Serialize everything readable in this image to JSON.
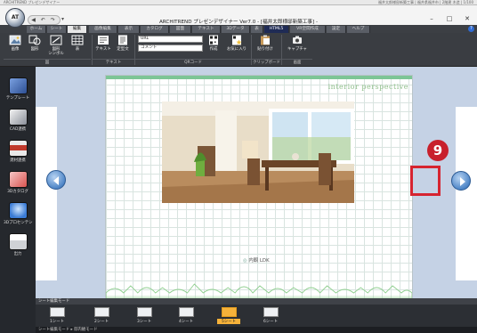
{
  "info_strip": {
    "left": "ARCHITREND プレゼンデザイナー",
    "right": "福井太郎様邸新築工事 | 福井県福井市 | 2階建 木造 | 1/100"
  },
  "window": {
    "orb_label": "AT",
    "qa_icons": "◀ ↶ ↷",
    "title": "ARCHITREND プレゼンデザイナー Ver7.0 - [福井太郎様邸新築工事] -",
    "minimize": "–",
    "maximize": "□",
    "close": "✕"
  },
  "tabs": [
    {
      "label": "ホーム",
      "state": "normal"
    },
    {
      "label": "シート",
      "state": "normal"
    },
    {
      "label": "編集",
      "state": "active"
    },
    {
      "label": "画像編集",
      "state": "normal"
    },
    {
      "label": "表示",
      "state": "normal"
    },
    {
      "label": "カタログ",
      "state": "normal"
    },
    {
      "label": "図面",
      "state": "normal"
    },
    {
      "label": "テキスト",
      "state": "normal"
    },
    {
      "label": "3Dデータ",
      "state": "normal"
    },
    {
      "label": "表",
      "state": "normal"
    },
    {
      "label": "HTML5",
      "state": "accent"
    },
    {
      "label": "VR空間作成",
      "state": "normal"
    },
    {
      "label": "設定",
      "state": "normal"
    },
    {
      "label": "ヘルプ",
      "state": "normal"
    }
  ],
  "help_label": "?",
  "ribbon": {
    "buttons": [
      {
        "label": "画像",
        "icon": "image-icon"
      },
      {
        "label": "図形",
        "icon": "shape-icon"
      },
      {
        "label": "図形\nシンボル",
        "icon": "symbol-icon"
      },
      {
        "label": "表",
        "icon": "table-icon"
      },
      {
        "label": "テキスト",
        "icon": "text-icon"
      },
      {
        "label": "定型文",
        "icon": "template-text-icon"
      },
      {
        "label": "作成",
        "icon": "qr-create-icon"
      },
      {
        "label": "お気に入り",
        "icon": "qr-favorite-icon"
      },
      {
        "label": "貼り付け",
        "icon": "paste-icon"
      },
      {
        "label": "キャプチャ",
        "icon": "capture-icon"
      }
    ],
    "qr_url_value": "URL",
    "qr_comment_value": "コメント",
    "groups": [
      "図",
      "テキスト",
      "QRコード",
      "クリップボード",
      "画面"
    ]
  },
  "left_toolbar": [
    {
      "label": "テンプレート",
      "icon": "template-icon",
      "color": "#4a6fb5"
    },
    {
      "label": "CAD連携",
      "icon": "cad-link-icon",
      "color": "#8a8f99"
    },
    {
      "label": "建材連携",
      "icon": "material-link-icon",
      "color": "#c0392b"
    },
    {
      "label": "3Dカタログ",
      "icon": "catalog-3d-icon",
      "color": "#d9534f"
    },
    {
      "label": "3Dプロセンテシ",
      "icon": "presentation-icon",
      "color": "#3a7bd5"
    },
    {
      "label": "出力",
      "icon": "print-icon",
      "color": "#dddddd"
    }
  ],
  "page": {
    "header_title": "interior perspective",
    "photo_caption": "内観 LDK",
    "accent_color": "#7dc596"
  },
  "nav": {
    "prev_label": "previous-page",
    "next_label": "next-page"
  },
  "annotation": {
    "step_number": "9",
    "color": "#c8202c"
  },
  "sheet_panel": {
    "mode_label": "シート編集モード",
    "sheets": [
      {
        "label": "1シート",
        "active": false
      },
      {
        "label": "2シート",
        "active": false
      },
      {
        "label": "3シート",
        "active": false
      },
      {
        "label": "4シート",
        "active": false
      },
      {
        "label": "5シート",
        "active": true
      },
      {
        "label": "6シート",
        "active": false
      }
    ]
  },
  "status_bar": {
    "text": "シート編集モード ▸ 邸内観モード"
  }
}
